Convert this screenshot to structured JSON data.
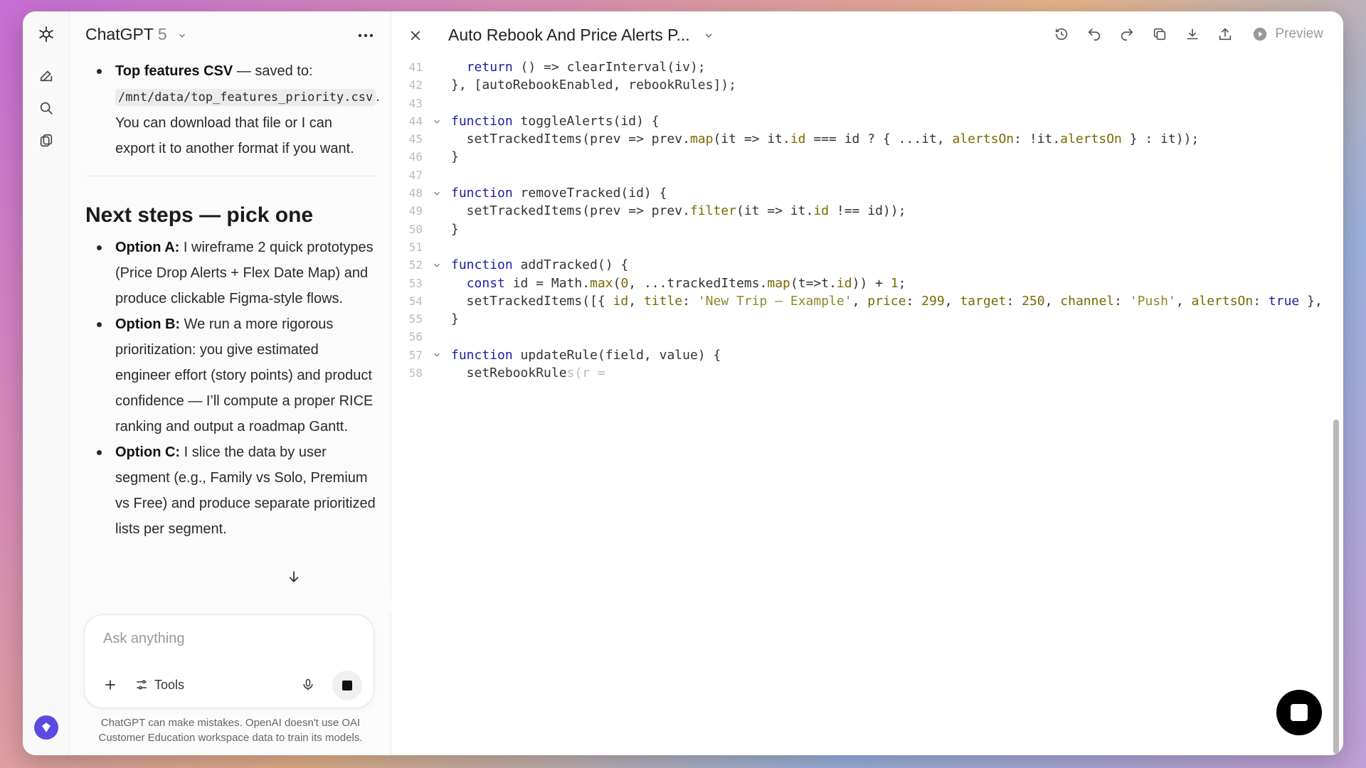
{
  "app": {
    "name": "ChatGPT",
    "version": "5"
  },
  "chat": {
    "bullet1": {
      "bold": "Top features CSV",
      "text_a": " — saved to: ",
      "code": "/mnt/data/top_features_priority.csv",
      "text_b": ". You can download that file or I can export it to another format if you want."
    },
    "heading": "Next steps — pick one",
    "options": [
      {
        "bold": "Option A:",
        "text": " I wireframe 2 quick prototypes (Price Drop Alerts + Flex Date Map) and produce clickable Figma-style flows."
      },
      {
        "bold": "Option B:",
        "text": " We run a more rigorous prioritization: you give estimated engineer effort (story points) and product confidence — I’ll compute a proper RICE ranking and output a roadmap Gantt."
      },
      {
        "bold": "Option C:",
        "text": " I slice the data by user segment (e.g., Family vs Solo, Premium vs Free) and produce separate prioritized lists per segment."
      }
    ]
  },
  "composer": {
    "placeholder": "Ask anything",
    "tools_label": "Tools"
  },
  "disclaimer": "ChatGPT can make mistakes. OpenAI doesn't use OAI Customer Education workspace data to train its models.",
  "editor": {
    "title": "Auto Rebook And Price Alerts P...",
    "preview_label": "Preview"
  },
  "code_lines": [
    {
      "n": "41",
      "fold": false,
      "html": "  <span class=\"kw\">return</span> () =&gt; clearInterval(iv);"
    },
    {
      "n": "42",
      "fold": false,
      "html": "}, [autoRebookEnabled, rebookRules]);"
    },
    {
      "n": "43",
      "fold": false,
      "html": ""
    },
    {
      "n": "44",
      "fold": true,
      "html": "<span class=\"kw\">function</span> toggleAlerts(id) {"
    },
    {
      "n": "45",
      "fold": false,
      "html": "  setTrackedItems(prev =&gt; prev.<span class=\"fn\">map</span>(it =&gt; it.<span class=\"prop\">id</span> === id ? { ...it, <span class=\"prop\">alertsOn</span>: !it.<span class=\"prop\">alertsOn</span> } : it));"
    },
    {
      "n": "46",
      "fold": false,
      "html": "}"
    },
    {
      "n": "47",
      "fold": false,
      "html": ""
    },
    {
      "n": "48",
      "fold": true,
      "html": "<span class=\"kw\">function</span> removeTracked(id) {"
    },
    {
      "n": "49",
      "fold": false,
      "html": "  setTrackedItems(prev =&gt; prev.<span class=\"fn\">filter</span>(it =&gt; it.<span class=\"prop\">id</span> !== id));"
    },
    {
      "n": "50",
      "fold": false,
      "html": "}"
    },
    {
      "n": "51",
      "fold": false,
      "html": ""
    },
    {
      "n": "52",
      "fold": true,
      "html": "<span class=\"kw\">function</span> addTracked() {"
    },
    {
      "n": "53",
      "fold": false,
      "html": "  <span class=\"kw\">const</span> id = Math.<span class=\"fn\">max</span>(<span class=\"num\">0</span>, ...trackedItems.<span class=\"fn\">map</span>(t=&gt;t.<span class=\"prop\">id</span>)) + <span class=\"num\">1</span>;"
    },
    {
      "n": "54",
      "fold": false,
      "html": "  setTrackedItems([{ <span class=\"prop\">id</span>, <span class=\"prop\">title</span>: <span class=\"str\">'New Trip — Example'</span>, <span class=\"prop\">price</span>: <span class=\"num\">299</span>, <span class=\"prop\">target</span>: <span class=\"num\">250</span>, <span class=\"prop\">channel</span>: <span class=\"str\">'Push'</span>, <span class=\"prop\">alertsOn</span>: <span class=\"kw\">true</span> },"
    },
    {
      "n": "55",
      "fold": false,
      "html": "}"
    },
    {
      "n": "56",
      "fold": false,
      "html": ""
    },
    {
      "n": "57",
      "fold": true,
      "html": "<span class=\"kw\">function</span> updateRule(field, value) {"
    },
    {
      "n": "58",
      "fold": false,
      "html": "  setRebookRule<span class=\"ghost\">s(r =</span>"
    }
  ],
  "colors": {
    "accent": "#5b4be0",
    "keyword": "#1e1e9e",
    "string": "#8a8a2a"
  }
}
